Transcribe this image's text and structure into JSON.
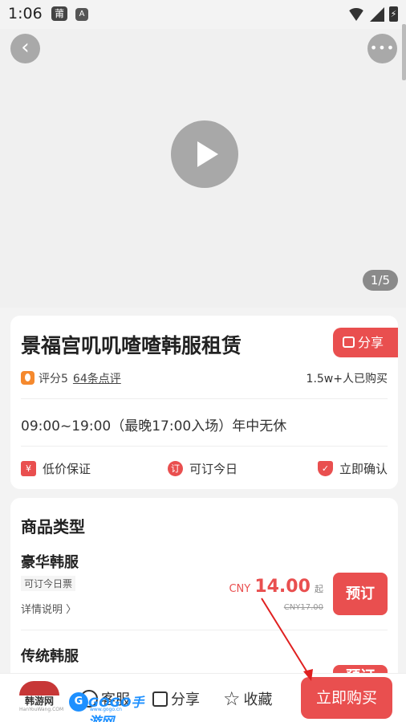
{
  "status_bar": {
    "time": "1:06",
    "notif_icon_1": "莆",
    "notif_icon_2": "A",
    "battery_glyph": "⚡"
  },
  "media": {
    "back_glyph": "‹",
    "more_glyph": "•••",
    "pager": "1/5"
  },
  "product": {
    "title": "景福宫叽叽喳喳韩服租赁",
    "share_label": "分享",
    "rating": "评分5",
    "reviews": "64条点评",
    "sold": "1.5w+人已购买",
    "hours": "09:00~19:00（最晚17:00入场）年中无休",
    "guarantees": [
      {
        "icon": "¥",
        "label": "低价保证"
      },
      {
        "icon": "订",
        "label": "可订今日"
      },
      {
        "icon": "✓",
        "label": "立即确认"
      }
    ]
  },
  "types": {
    "section_title": "商品类型",
    "items": [
      {
        "name": "豪华韩服",
        "tag": "可订今日票",
        "detail": "详情说明 〉",
        "currency": "CNY",
        "price": "14.00",
        "qi": "起",
        "orig_price": "CNY17.00",
        "book": "预订"
      },
      {
        "name": "传统韩服",
        "book": "预订"
      }
    ]
  },
  "bottom_bar": {
    "logo_text": "韩游网",
    "logo_sub": "HanYouWang.COM",
    "service": "客服",
    "share": "分享",
    "favorite": "收藏",
    "star_glyph": "☆",
    "buy": "立即购买"
  },
  "watermark": {
    "badge": "G",
    "text": "GOGO手游网",
    "url": "www.gogo.cn"
  },
  "colors": {
    "accent": "#e94f4f",
    "background": "#f3f3f3"
  }
}
